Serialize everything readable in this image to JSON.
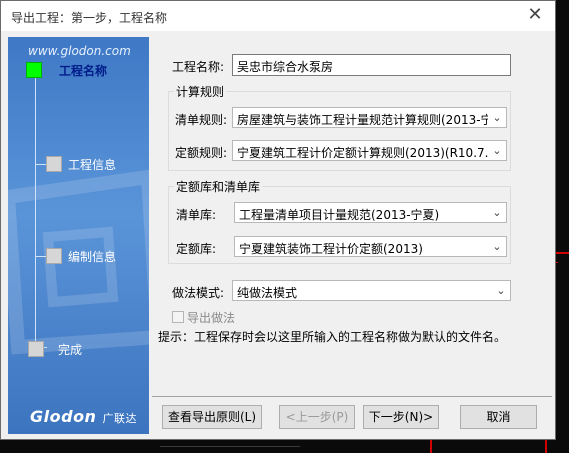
{
  "window": {
    "title": "导出工程：第一步，工程名称",
    "close_glyph": "✕"
  },
  "sidebar": {
    "url": "www.glodon.com",
    "steps": [
      {
        "label": "工程名称",
        "active": true
      },
      {
        "label": "工程信息",
        "active": false
      },
      {
        "label": "编制信息",
        "active": false
      },
      {
        "label": "完成",
        "active": false
      }
    ],
    "logo": "Glodon",
    "logo_cn": "广联达"
  },
  "form": {
    "project_name_label": "工程名称:",
    "project_name_value": "吴忠市综合水泵房",
    "calc_rules": {
      "title": "计算规则",
      "list_rule_label": "清单规则:",
      "list_rule_value": "房屋建筑与装饰工程计量规范计算规则(2013-宁",
      "quota_rule_label": "定额规则:",
      "quota_rule_value": "宁夏建筑工程计价定额计算规则(2013)(R10.7."
    },
    "libraries": {
      "title": "定额库和清单库",
      "list_lib_label": "清单库:",
      "list_lib_value": "工程量清单项目计量规范(2013-宁夏)",
      "quota_lib_label": "定额库:",
      "quota_lib_value": "宁夏建筑装饰工程计价定额(2013)"
    },
    "method_label": "做法模式:",
    "method_value": "纯做法模式",
    "export_method_label": "导出做法",
    "hint": "提示：工程保存时会以这里所输入的工程名称做为默认的文件名。"
  },
  "buttons": {
    "view_rules": "查看导出原则(L)",
    "prev": "<上一步(P)",
    "next": "下一步(N)>",
    "cancel": "取消"
  },
  "icons": {
    "chevron": "⌄"
  }
}
